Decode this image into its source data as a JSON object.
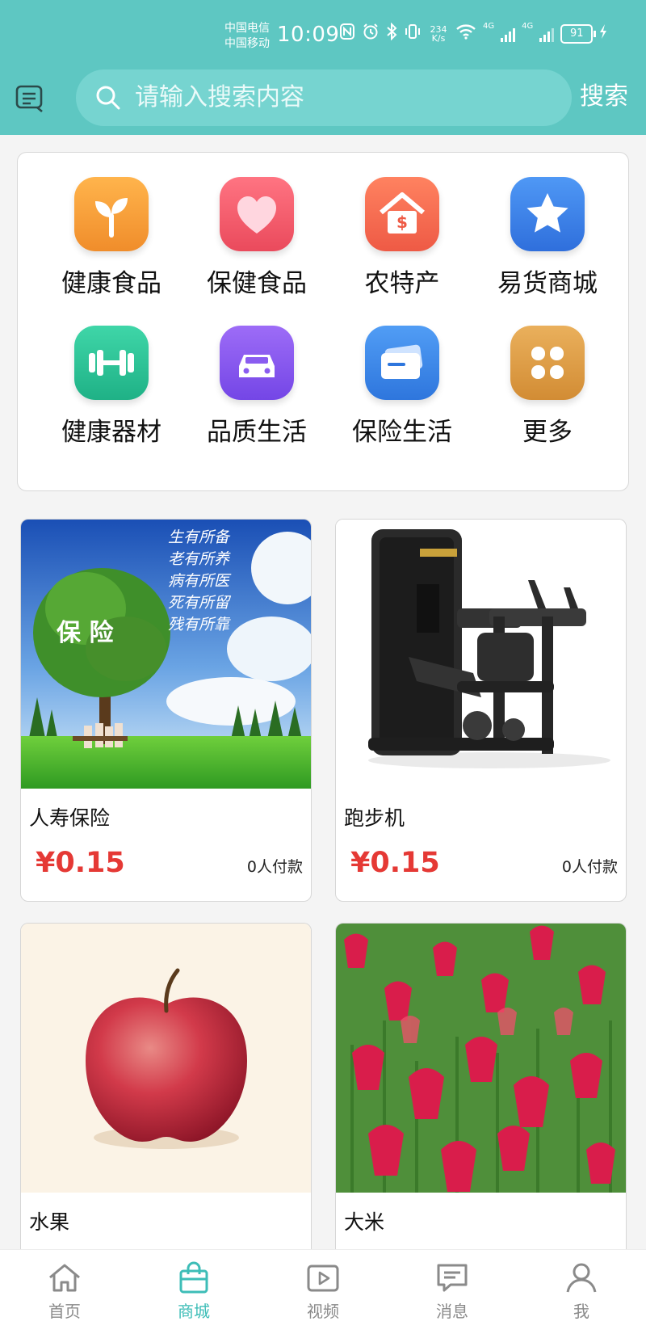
{
  "status_bar": {
    "carrier1": "中国电信",
    "carrier2": "中国移动",
    "time": "10:09",
    "net_speed_value": "234",
    "net_speed_unit": "K/s",
    "network1": "4G",
    "network2": "4G",
    "battery": "91"
  },
  "search": {
    "placeholder": "请输入搜索内容",
    "button": "搜索"
  },
  "categories": [
    {
      "label": "健康食品",
      "icon": "sprout-icon",
      "color": "#f7a33a"
    },
    {
      "label": "保健食品",
      "icon": "heart-icon",
      "color": "#f05b6b"
    },
    {
      "label": "农特产",
      "icon": "house-dollar-icon",
      "color": "#f26a52"
    },
    {
      "label": "易货商城",
      "icon": "star-icon",
      "color": "#3f86ea"
    },
    {
      "label": "健康器材",
      "icon": "dumbbell-icon",
      "color": "#2fc49a"
    },
    {
      "label": "品质生活",
      "icon": "car-icon",
      "color": "#8a5cf0"
    },
    {
      "label": "保险生活",
      "icon": "card-icon",
      "color": "#3d8ce8"
    },
    {
      "label": "更多",
      "icon": "grid-icon",
      "color": "#e0a04a"
    }
  ],
  "products": [
    {
      "name": "人寿保险",
      "price": "¥0.15",
      "sales": "0人付款",
      "image_text": [
        "生有所备",
        "老有所养",
        "病有所医",
        "死有所留",
        "残有所靠"
      ],
      "image_overlay": "保   险"
    },
    {
      "name": "跑步机",
      "price": "¥0.15",
      "sales": "0人付款"
    },
    {
      "name": "水果"
    },
    {
      "name": "大米"
    }
  ],
  "tabs": [
    {
      "label": "首页",
      "icon": "home-icon"
    },
    {
      "label": "商城",
      "icon": "shopping-bag-icon"
    },
    {
      "label": "视频",
      "icon": "video-icon"
    },
    {
      "label": "消息",
      "icon": "message-icon"
    },
    {
      "label": "我",
      "icon": "user-icon"
    }
  ],
  "active_tab": "商城",
  "colors": {
    "header": "#5ec7c2",
    "accent": "#3dbdb7",
    "price": "#e53935"
  }
}
